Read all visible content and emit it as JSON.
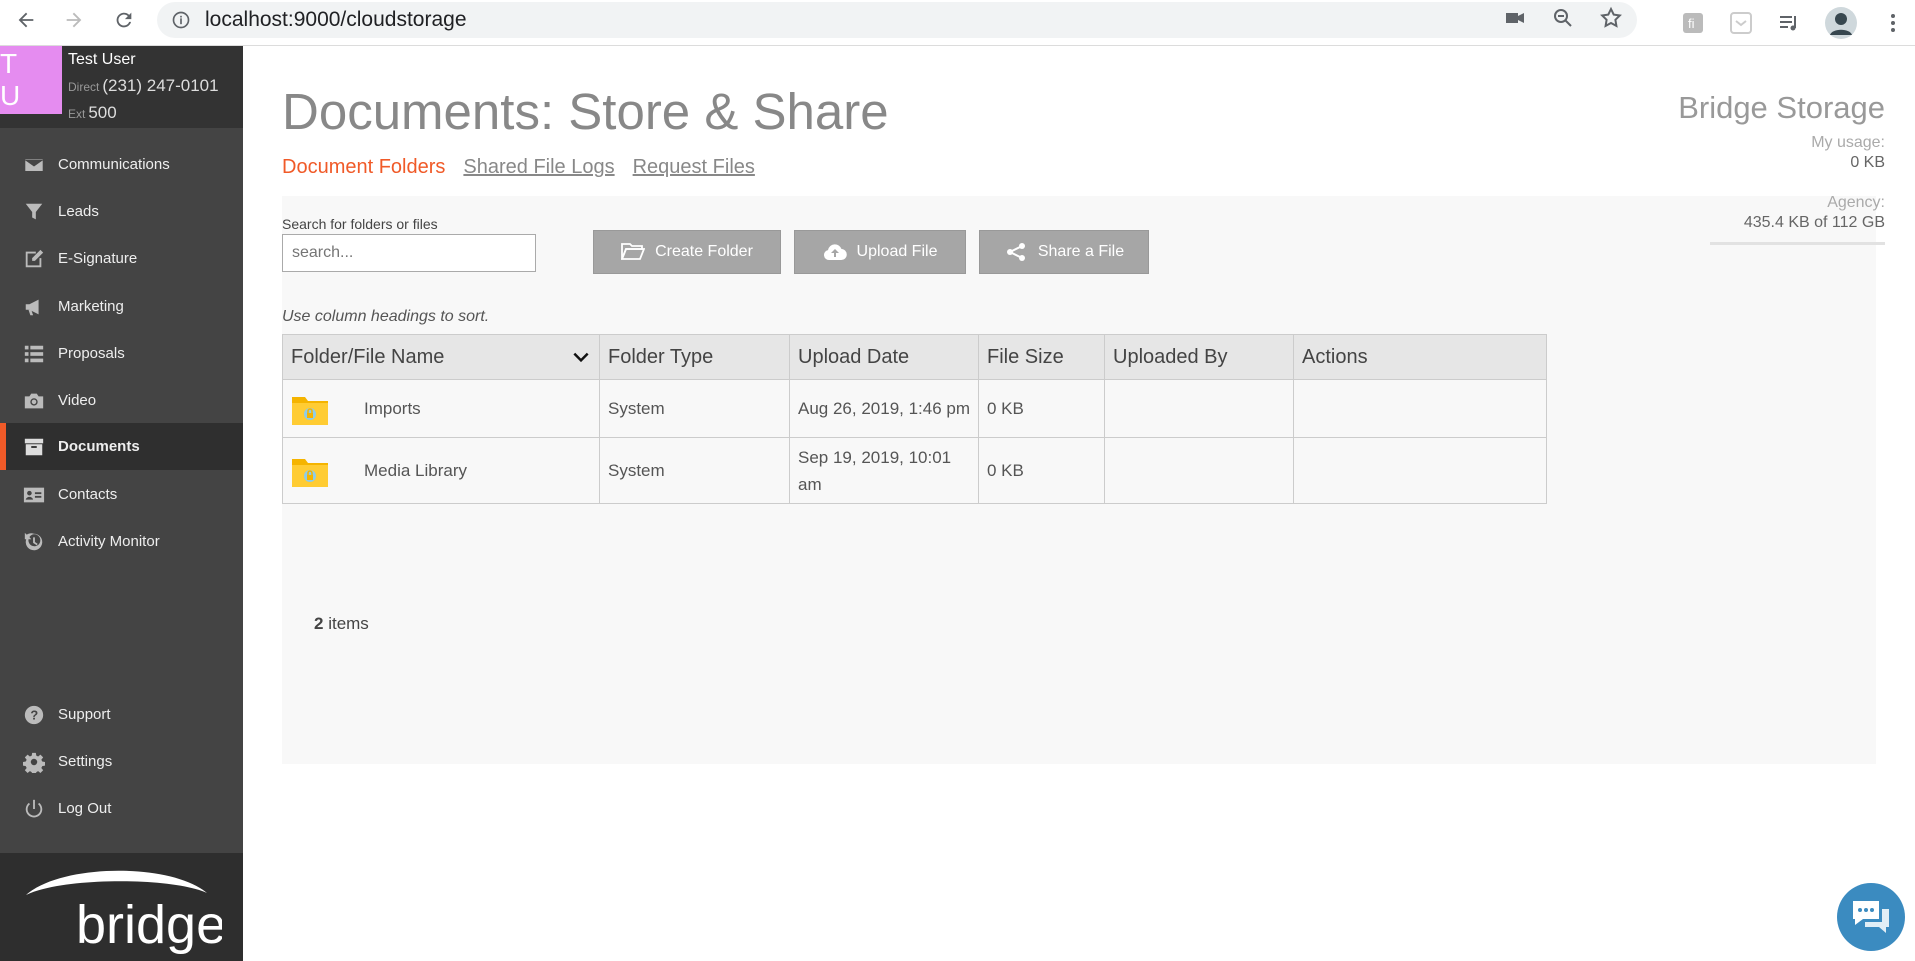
{
  "browser": {
    "url": "localhost:9000/cloudstorage"
  },
  "profile": {
    "initials": "T U",
    "name": "Test User",
    "direct_label": "Direct",
    "direct_phone": "(231) 247-0101",
    "ext_label": "Ext",
    "ext": "500"
  },
  "sidebar": {
    "items": [
      {
        "label": "Communications",
        "icon": "envelope-icon"
      },
      {
        "label": "Leads",
        "icon": "funnel-icon"
      },
      {
        "label": "E-Signature",
        "icon": "pen-icon"
      },
      {
        "label": "Marketing",
        "icon": "megaphone-icon"
      },
      {
        "label": "Proposals",
        "icon": "list-icon"
      },
      {
        "label": "Video",
        "icon": "camera-icon"
      },
      {
        "label": "Documents",
        "icon": "archive-icon",
        "active": true
      },
      {
        "label": "Contacts",
        "icon": "contact-card-icon"
      },
      {
        "label": "Activity Monitor",
        "icon": "history-icon"
      }
    ],
    "bottom_items": [
      {
        "label": "Support",
        "icon": "question-icon"
      },
      {
        "label": "Settings",
        "icon": "gear-icon"
      },
      {
        "label": "Log Out",
        "icon": "power-icon"
      }
    ],
    "brand": "bridge"
  },
  "main": {
    "title": "Documents: Store & Share",
    "tabs": [
      {
        "label": "Document Folders",
        "active": true
      },
      {
        "label": "Shared File Logs"
      },
      {
        "label": "Request Files"
      }
    ],
    "storage": {
      "title": "Bridge Storage",
      "my_usage_label": "My usage:",
      "my_usage_value": "0 KB",
      "agency_label": "Agency:",
      "agency_value": "435.4 KB of 112 GB"
    },
    "search": {
      "label": "Search for folders or files",
      "placeholder": "search..."
    },
    "buttons": {
      "create_folder": "Create Folder",
      "upload_file": "Upload File",
      "share_file": "Share a File"
    },
    "sort_hint": "Use column headings to sort.",
    "table": {
      "headers": [
        "Folder/File Name",
        "Folder Type",
        "Upload Date",
        "File Size",
        "Uploaded By",
        "Actions"
      ],
      "rows": [
        {
          "name": "Imports",
          "type": "System",
          "date": "Aug 26, 2019, 1:46 pm",
          "size": "0 KB",
          "uploaded_by": "",
          "actions": ""
        },
        {
          "name": "Media Library",
          "type": "System",
          "date": "Sep 19, 2019, 10:01 am",
          "size": "0 KB",
          "uploaded_by": "",
          "actions": ""
        }
      ]
    },
    "count_number": "2",
    "count_label": " items"
  },
  "colors": {
    "accent": "#f05a28",
    "sidebar_bg": "#444444",
    "avatar_bg": "#e58cf0",
    "button_bg": "#a6a6a6",
    "chat_bg": "#3b8bc0"
  }
}
